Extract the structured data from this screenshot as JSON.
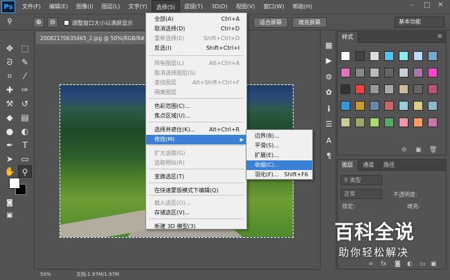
{
  "app": {
    "logo": "Ps"
  },
  "menubar": {
    "items": [
      "文件(F)",
      "编辑(E)",
      "图像(I)",
      "图层(L)",
      "文字(Y)",
      "选择(S)",
      "滤镜(T)",
      "3D(D)",
      "视图(V)",
      "窗口(W)",
      "帮助(H)"
    ]
  },
  "window_controls": {
    "minimize": "–",
    "maximize": "□",
    "close": "✕"
  },
  "options_bar": {
    "resize_windows_label": "调整窗口大小以满屏显示",
    "fit_screen": "适合屏幕",
    "fill_screen": "填充屏幕",
    "workspace": "基本功能"
  },
  "document": {
    "tab_title": "20082170635465_2.jpg @ 50%(RGB/8#)",
    "zoom": "50%",
    "doc_info": "文档:1.97M/1.97M"
  },
  "select_menu": {
    "items": [
      {
        "label": "全部(A)",
        "shortcut": "Ctrl+A",
        "disabled": false
      },
      {
        "label": "取消选择(D)",
        "shortcut": "Ctrl+D",
        "disabled": false
      },
      {
        "label": "重新选择(E)",
        "shortcut": "Shift+Ctrl+D",
        "disabled": true
      },
      {
        "label": "反选(I)",
        "shortcut": "Shift+Ctrl+I",
        "disabled": false
      },
      {
        "label": "所有图层(L)",
        "shortcut": "Alt+Ctrl+A",
        "disabled": true
      },
      {
        "label": "取消选择图层(S)",
        "shortcut": "",
        "disabled": true
      },
      {
        "label": "查找图层",
        "shortcut": "Alt+Shift+Ctrl+F",
        "disabled": true
      },
      {
        "label": "隔离图层",
        "shortcut": "",
        "disabled": true
      },
      {
        "label": "色彩范围(C)...",
        "shortcut": "",
        "disabled": false
      },
      {
        "label": "焦点区域(U)...",
        "shortcut": "",
        "disabled": false
      },
      {
        "label": "选择并遮住(K)...",
        "shortcut": "Alt+Ctrl+R",
        "disabled": false
      },
      {
        "label": "修改(M)",
        "shortcut": "",
        "disabled": false,
        "highlighted": true
      },
      {
        "label": "扩大选取(G)",
        "shortcut": "",
        "disabled": true
      },
      {
        "label": "选取相似(R)",
        "shortcut": "",
        "disabled": true
      },
      {
        "label": "变换选区(T)",
        "shortcut": "",
        "disabled": false
      },
      {
        "label": "在快速蒙版模式下编辑(Q)",
        "shortcut": "",
        "disabled": false
      },
      {
        "label": "载入选区(O)...",
        "shortcut": "",
        "disabled": true
      },
      {
        "label": "存储选区(V)...",
        "shortcut": "",
        "disabled": false
      },
      {
        "label": "新建 3D 模型(3)",
        "shortcut": "",
        "disabled": false
      }
    ]
  },
  "modify_submenu": {
    "items": [
      {
        "label": "边界(B)...",
        "shortcut": ""
      },
      {
        "label": "平滑(S)...",
        "shortcut": ""
      },
      {
        "label": "扩展(E)...",
        "shortcut": ""
      },
      {
        "label": "收缩(C)...",
        "shortcut": "",
        "highlighted": true
      },
      {
        "label": "羽化(F)...",
        "shortcut": "Shift+F6"
      }
    ]
  },
  "styles_panel": {
    "tab": "样式"
  },
  "layers_panel": {
    "tabs": [
      "图层",
      "通道",
      "路径"
    ],
    "kind_label": "类型",
    "blend_mode": "正常",
    "opacity_label": "不透明度:",
    "lock_label": "锁定:",
    "fill_label": "填充:"
  },
  "watermark": {
    "line1": "百科全说",
    "line2": "助你轻松解决"
  },
  "colors": {
    "highlight": "#3a80d6",
    "ui_bg": "#535353",
    "menu_bg": "#f0f0f0"
  }
}
